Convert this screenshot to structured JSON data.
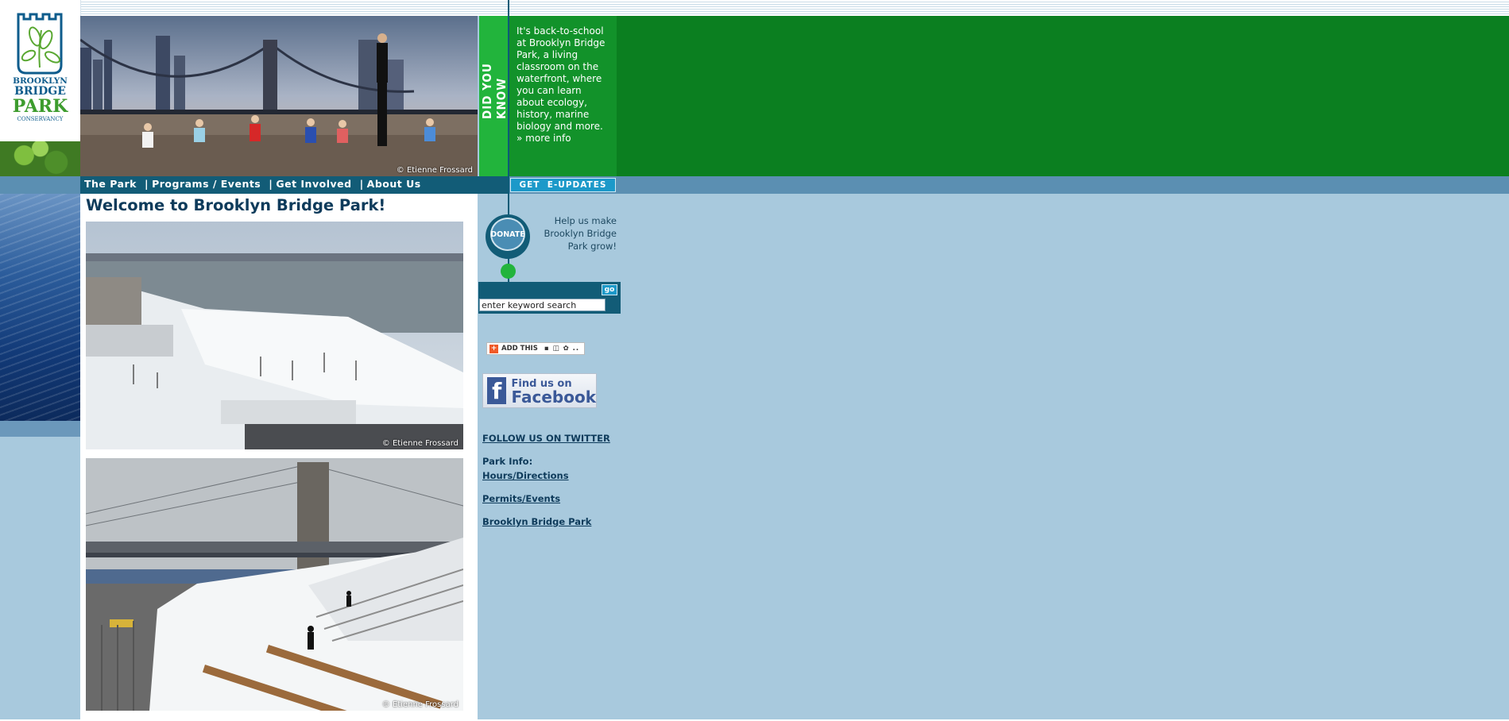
{
  "logo": {
    "line1": "BROOKLYN",
    "line2": "BRIDGE",
    "line3": "PARK",
    "line4": "CONSERVANCY",
    "icon": "leaf-logo-icon"
  },
  "header": {
    "photo_credit": "© Etienne Frossard",
    "did_you_know_label": "DID YOU KNOW",
    "did_you_know_text": "It's back-to-school at Brooklyn Bridge Park, a living classroom on the waterfront, where you can learn about ecology, history, marine biology and more.",
    "more_info_link": "» more info"
  },
  "nav": {
    "items": [
      {
        "label": "The Park"
      },
      {
        "label": "Programs / Events"
      },
      {
        "label": "Get Involved"
      },
      {
        "label": "About Us"
      }
    ],
    "separator": "|",
    "eupdates_button": "GET  E-UPDATES"
  },
  "main": {
    "title": "Welcome to Brooklyn Bridge Park!",
    "photo1_credit": "© Etienne Frossard",
    "photo2_credit": "© Etienne Frossard"
  },
  "sidebar": {
    "donate_button": "DONATE",
    "donate_copy": "Help us make Brooklyn Bridge Park grow!",
    "search_go": "go",
    "search_value": "enter keyword search",
    "addthis_label": "ADD THIS",
    "facebook_line1": "Find us on",
    "facebook_line2": "Facebook",
    "twitter_link": "FOLLOW US ON TWITTER",
    "park_info_label": "Park Info:",
    "links": [
      {
        "label": "Hours/Directions"
      },
      {
        "label": "Permits/Events"
      },
      {
        "label": "Brooklyn Bridge Park"
      }
    ]
  },
  "colors": {
    "nav_dark": "#125c77",
    "green_bright": "#22b43c",
    "green_dark": "#0b7f20",
    "page_bg": "#a8c9dd"
  }
}
